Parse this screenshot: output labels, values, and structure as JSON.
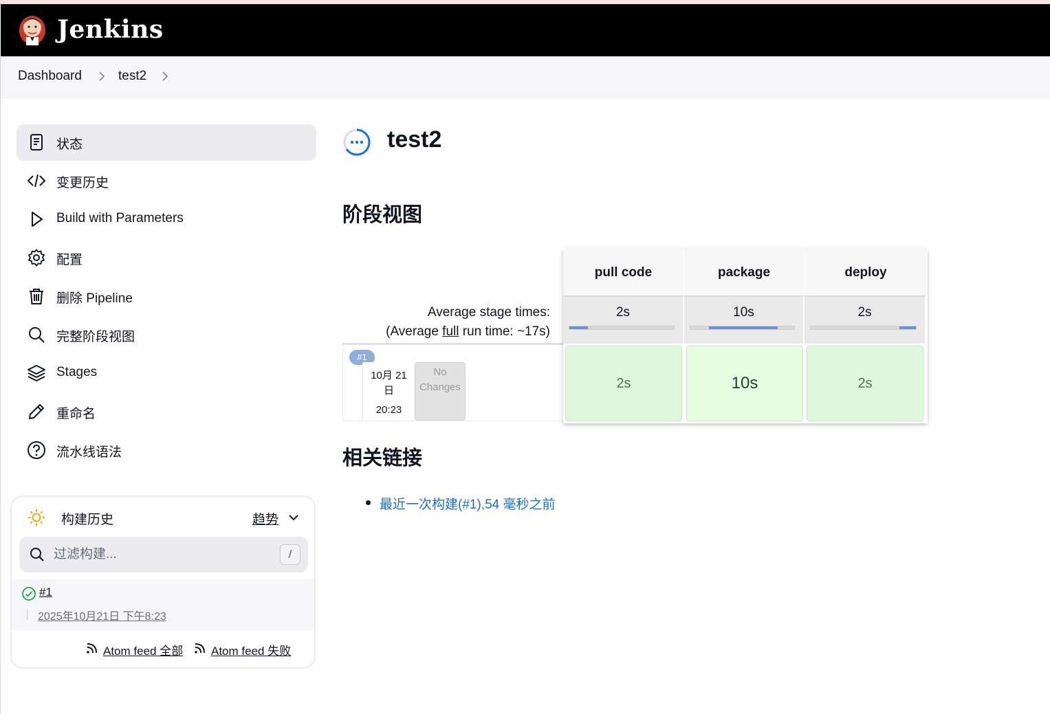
{
  "app": {
    "brand": "Jenkins"
  },
  "breadcrumb": {
    "items": [
      "Dashboard",
      "test2"
    ]
  },
  "sidebar": {
    "items": [
      {
        "label": "状态",
        "icon": "document-icon",
        "active": true
      },
      {
        "label": "变更历史",
        "icon": "code-icon"
      },
      {
        "label": "Build with Parameters",
        "icon": "play-icon"
      },
      {
        "label": "配置",
        "icon": "gear-icon"
      },
      {
        "label": "删除 Pipeline",
        "icon": "trash-icon"
      },
      {
        "label": "完整阶段视图",
        "icon": "search-icon"
      },
      {
        "label": "Stages",
        "icon": "layers-icon"
      },
      {
        "label": "重命名",
        "icon": "pencil-icon"
      },
      {
        "label": "流水线语法",
        "icon": "help-icon"
      }
    ]
  },
  "build_history": {
    "title": "构建历史",
    "trend": "趋势",
    "search_placeholder": "过滤构建...",
    "shortcut": "/",
    "builds": [
      {
        "number": "#1",
        "date": "2025年10月21日 下午8:23",
        "status": "success"
      }
    ],
    "feeds": [
      "Atom feed 全部",
      "Atom feed 失败"
    ]
  },
  "main": {
    "job_title": "test2",
    "stage_view_heading": "阶段视图",
    "related_links_heading": "相关链接",
    "links": [
      "最近一次构建(#1),54 毫秒之前"
    ]
  },
  "stage_view": {
    "stages": [
      "pull code",
      "package",
      "deploy"
    ],
    "average_label": "Average stage times:",
    "average_full_prefix": "(Average ",
    "average_full_word": "full",
    "average_full_suffix": " run time: ~17s)",
    "average_times": [
      "2s",
      "10s",
      "2s"
    ],
    "average_bar_fill": [
      {
        "start": 0.0,
        "end": 0.18
      },
      {
        "start": 0.18,
        "end": 0.84
      },
      {
        "start": 0.84,
        "end": 1.0
      }
    ],
    "runs": [
      {
        "badge": "#1",
        "date_line1": "10月 21",
        "date_line2": "日",
        "time": "20:23",
        "changes": "No Changes",
        "durations": [
          "2s",
          "10s",
          "2s"
        ]
      }
    ]
  },
  "colors": {
    "header_bg": "#000000",
    "link": "#1a6fc4",
    "success": "#1ea446",
    "stage_success_bg": "#dff7dc",
    "stage_bar": "#6d92cf"
  }
}
